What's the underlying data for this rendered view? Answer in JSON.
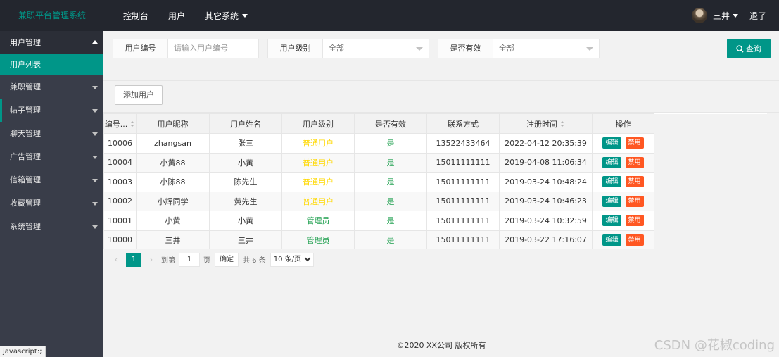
{
  "header": {
    "app_title": "兼职平台管理系统",
    "nav": [
      "控制台",
      "用户",
      "其它系统"
    ],
    "user_name": "三井",
    "logout": "退了"
  },
  "sidebar": {
    "items": [
      {
        "label": "用户管理"
      },
      {
        "label": "用户列表"
      },
      {
        "label": "兼职管理"
      },
      {
        "label": "帖子管理"
      },
      {
        "label": "聊天管理"
      },
      {
        "label": "广告管理"
      },
      {
        "label": "信箱管理"
      },
      {
        "label": "收藏管理"
      },
      {
        "label": "系统管理"
      }
    ],
    "status_hint": "javascript:;"
  },
  "search": {
    "user_id_label": "用户编号",
    "user_id_placeholder": "请输入用户编号",
    "level_label": "用户级别",
    "level_value": "全部",
    "valid_label": "是否有效",
    "valid_value": "全部",
    "query_button": "查询"
  },
  "toolbar": {
    "add_user": "添加用户"
  },
  "table": {
    "headers": [
      "编号...",
      "用户昵称",
      "用户姓名",
      "用户级别",
      "是否有效",
      "联系方式",
      "注册时间",
      "操作"
    ],
    "rows": [
      {
        "id": "10006",
        "nickname": "zhangsan",
        "name": "张三",
        "level": "普通用户",
        "valid": "是",
        "phone": "13522433464",
        "reg_time": "2022-04-12 20:35:39"
      },
      {
        "id": "10004",
        "nickname": "小黄88",
        "name": "小黄",
        "level": "普通用户",
        "valid": "是",
        "phone": "15011111111",
        "reg_time": "2019-04-08 11:06:34"
      },
      {
        "id": "10003",
        "nickname": "小陈88",
        "name": "陈先生",
        "level": "普通用户",
        "valid": "是",
        "phone": "15011111111",
        "reg_time": "2019-03-24 10:48:24"
      },
      {
        "id": "10002",
        "nickname": "小辉同学",
        "name": "黄先生",
        "level": "普通用户",
        "valid": "是",
        "phone": "15011111111",
        "reg_time": "2019-03-24 10:46:23"
      },
      {
        "id": "10001",
        "nickname": "小黄",
        "name": "小黄",
        "level": "管理员",
        "valid": "是",
        "phone": "15011111111",
        "reg_time": "2019-03-24 10:32:59"
      },
      {
        "id": "10000",
        "nickname": "三井",
        "name": "三井",
        "level": "管理员",
        "valid": "是",
        "phone": "15011111111",
        "reg_time": "2019-03-22 17:16:07"
      }
    ],
    "op_edit": "编辑",
    "op_ban": "禁用"
  },
  "pager": {
    "current": "1",
    "goto_prefix": "到第",
    "goto_value": "1",
    "page_word": "页",
    "confirm": "确定",
    "total": "共 6 条",
    "per_page": "10 条/页"
  },
  "footer": {
    "copyright": "©2020 XX公司 版权所有"
  },
  "watermark": "CSDN @花椒coding",
  "colors": {
    "accent": "#009688",
    "header_bg": "#23262e",
    "sidebar_bg": "#393d49",
    "ban_button": "#ff5722",
    "normal_level": "#ffd800",
    "admin_level": "#1e9f4e"
  }
}
